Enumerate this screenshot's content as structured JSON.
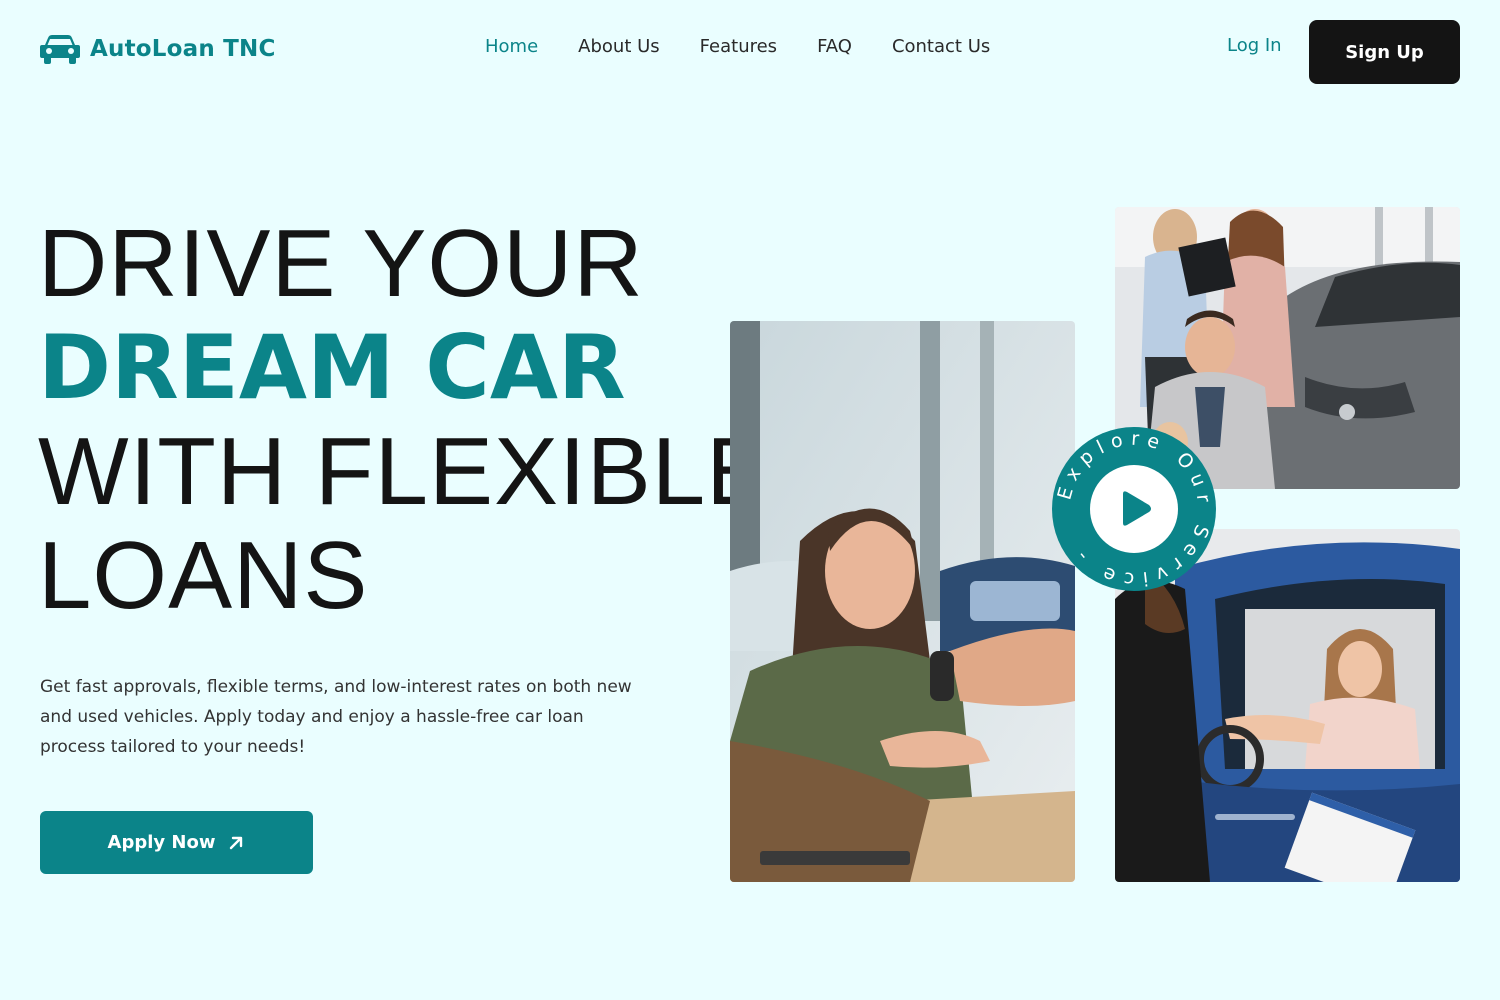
{
  "brand": {
    "name": "AutoLoan TNC",
    "icon": "car-icon",
    "color": "#0b8489"
  },
  "nav": {
    "items": [
      {
        "label": "Home",
        "active": true
      },
      {
        "label": "About Us",
        "active": false
      },
      {
        "label": "Features",
        "active": false
      },
      {
        "label": "FAQ",
        "active": false
      },
      {
        "label": "Contact Us",
        "active": false
      }
    ]
  },
  "auth": {
    "login_label": "Log In",
    "signup_label": "Sign Up"
  },
  "hero": {
    "line1": "DRIVE YOUR",
    "line2": "DREAM CAR",
    "line3": "WITH FLEXIBLE",
    "line4": "LOANS",
    "description": "Get fast approvals, flexible terms, and low-interest rates on both new and used vehicles. Apply today and enjoy a hassle-free car loan process tailored to your needs!",
    "cta_label": "Apply Now",
    "cta_icon": "arrow-up-right-icon"
  },
  "explore": {
    "text": "Explore Our Service -",
    "icon": "play-icon"
  },
  "colors": {
    "accent": "#0b8489",
    "background": "#eafeff",
    "dark": "#141414"
  }
}
